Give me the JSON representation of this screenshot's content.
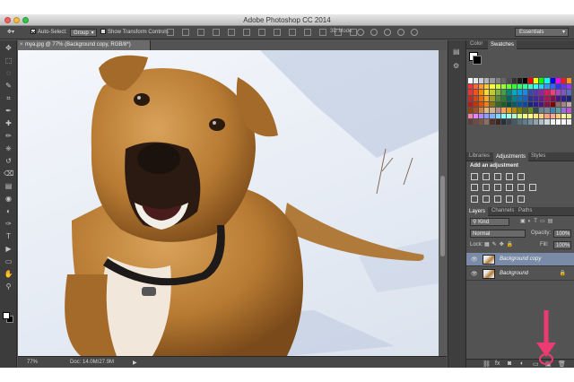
{
  "app": {
    "title": "Adobe Photoshop CC 2014"
  },
  "options_bar": {
    "auto_select_label": "Auto-Select:",
    "auto_select_checked": true,
    "auto_select_value": "Group",
    "show_transform_label": "Show Transform Controls",
    "mode_label": "3D Mode:",
    "workspace": "Essentials"
  },
  "document": {
    "tab_title": "mya.jpg @ 77% (Background copy, RGB/8*)",
    "zoom": "77%",
    "doc_info": "Doc: 14.0M/27.9M"
  },
  "tools": [
    "move-tool-icon",
    "marquee-tool-icon",
    "lasso-tool-icon",
    "quick-selection-tool-icon",
    "crop-tool-icon",
    "eyedropper-tool-icon",
    "healing-brush-tool-icon",
    "brush-tool-icon",
    "clone-stamp-tool-icon",
    "history-brush-tool-icon",
    "eraser-tool-icon",
    "gradient-tool-icon",
    "blur-tool-icon",
    "dodge-tool-icon",
    "pen-tool-icon",
    "type-tool-icon",
    "path-selection-tool-icon",
    "shape-tool-icon",
    "hand-tool-icon",
    "zoom-tool-icon"
  ],
  "tool_glyphs": [
    "✥",
    "⬚",
    "◌",
    "✎",
    "⌗",
    "✒",
    "✚",
    "✏",
    "⎈",
    "↺",
    "⌫",
    "▤",
    "◉",
    "◐",
    "✑",
    "T",
    "▶",
    "▭",
    "✋",
    "⚲"
  ],
  "color_panel": {
    "tabs": [
      "Color",
      "Swatches"
    ],
    "active_tab": "Swatches",
    "swatch_colors": [
      "#ffffff",
      "#e6e6e6",
      "#cccccc",
      "#b3b3b3",
      "#999999",
      "#808080",
      "#666666",
      "#4d4d4d",
      "#333333",
      "#1a1a1a",
      "#000000",
      "#ff0000",
      "#ffff00",
      "#00ff00",
      "#00ffff",
      "#0000ff",
      "#ff00ff",
      "#ed1c24",
      "#f7941d",
      "#ff3333",
      "#ff6633",
      "#ff9933",
      "#ffcc33",
      "#ffff33",
      "#ccff33",
      "#99ff33",
      "#66ff33",
      "#33ff33",
      "#33ff66",
      "#33ff99",
      "#33ffcc",
      "#33ffff",
      "#33ccff",
      "#3399ff",
      "#3366ff",
      "#3333ff",
      "#6633ff",
      "#9933ff",
      "#e53935",
      "#f4511e",
      "#fb8c00",
      "#fdd835",
      "#c0ca33",
      "#7cb342",
      "#43a047",
      "#00897b",
      "#00acc1",
      "#039be5",
      "#1e88e5",
      "#3949ab",
      "#5e35b1",
      "#8e24aa",
      "#d81b60",
      "#ec407a",
      "#ab47bc",
      "#7e57c2",
      "#5c6bc0",
      "#c62828",
      "#d84315",
      "#ef6c00",
      "#f9a825",
      "#9e9d24",
      "#558b2f",
      "#2e7d32",
      "#00695c",
      "#00838f",
      "#0277bd",
      "#1565c0",
      "#283593",
      "#4527a0",
      "#6a1b9a",
      "#ad1457",
      "#880e4f",
      "#4a148c",
      "#311b92",
      "#1a237e",
      "#b71c1c",
      "#bf360c",
      "#e65100",
      "#f57f17",
      "#827717",
      "#33691e",
      "#1b5e20",
      "#004d40",
      "#006064",
      "#01579b",
      "#0d47a1",
      "#1a237e",
      "#311b92",
      "#4a148c",
      "#880e4f",
      "#7f0000",
      "#8d6e63",
      "#a1887f",
      "#bcaaa4",
      "#8b4513",
      "#a0522d",
      "#cd853f",
      "#deb887",
      "#d2b48c",
      "#bc8f8f",
      "#f4a460",
      "#daa520",
      "#b8860b",
      "#808000",
      "#556b2f",
      "#6b8e23",
      "#2f4f4f",
      "#708090",
      "#778899",
      "#4682b4",
      "#5f9ea0",
      "#9370db",
      "#ba55d3",
      "#ff80ab",
      "#ea80fc",
      "#b388ff",
      "#8c9eff",
      "#82b1ff",
      "#80d8ff",
      "#84ffff",
      "#a7ffeb",
      "#b9f6ca",
      "#ccff90",
      "#f4ff81",
      "#ffff8d",
      "#ffe57f",
      "#ffd180",
      "#ff9e80",
      "#ffab91",
      "#ffcc80",
      "#fff59d",
      "#e6ee9c",
      "#5d4037",
      "#6d4c41",
      "#795548",
      "#8d6e63",
      "#4e342e",
      "#3e2723",
      "#263238",
      "#37474f",
      "#455a64",
      "#546e7a",
      "#607d8b",
      "#78909c",
      "#90a4ae",
      "#b0bec5",
      "#cfd8dc",
      "#eceff1",
      "#fafafa",
      "#f5f5f5",
      "#eeeeee"
    ]
  },
  "adjustments_panel": {
    "tabs": [
      "Libraries",
      "Adjustments",
      "Styles"
    ],
    "active_tab": "Adjustments",
    "title": "Add an adjustment"
  },
  "layers_panel": {
    "tabs": [
      "Layers",
      "Channels",
      "Paths"
    ],
    "active_tab": "Layers",
    "filter_kind": "Kind",
    "blend_mode": "Normal",
    "opacity_label": "Opacity:",
    "opacity": "100%",
    "lock_label": "Lock:",
    "fill_label": "Fill:",
    "fill": "100%",
    "layers": [
      {
        "name": "Background copy",
        "selected": true,
        "locked": false
      },
      {
        "name": "Background",
        "selected": false,
        "locked": true
      }
    ]
  },
  "colors": {
    "annotation_arrow": "#ec3a72",
    "selected_layer": "#7a8ba8"
  }
}
